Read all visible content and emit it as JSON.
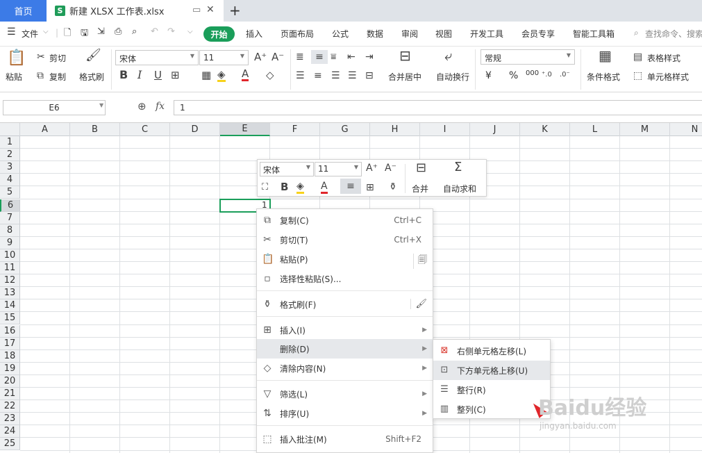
{
  "tabs": {
    "home": "首页",
    "file_logo": "S",
    "file": "新建 XLSX 工作表.xlsx",
    "add": "+"
  },
  "menu": {
    "file_menu": "文件",
    "items": [
      "开始",
      "插入",
      "页面布局",
      "公式",
      "数据",
      "审阅",
      "视图",
      "开发工具",
      "会员专享",
      "智能工具箱"
    ],
    "search": "查找命令、搜索"
  },
  "ribbon": {
    "paste": "粘贴",
    "cut": "剪切",
    "copy": "复制",
    "format_painter": "格式刷",
    "font_name": "宋体",
    "font_size": "11",
    "merge_center": "合并居中",
    "wrap_text": "自动换行",
    "number_format": "常规",
    "conditional_format": "条件格式",
    "table_style": "表格样式",
    "cell_style": "单元格样式",
    "currency": "¥",
    "percent": "%",
    "thousands": "000"
  },
  "formula_bar": {
    "cell_ref": "E6",
    "fx": "fx",
    "value": "1"
  },
  "grid": {
    "columns": [
      "A",
      "B",
      "C",
      "D",
      "E",
      "F",
      "G",
      "H",
      "I",
      "J",
      "K",
      "L",
      "M",
      "N"
    ],
    "rows": [
      "1",
      "2",
      "3",
      "4",
      "5",
      "6",
      "7",
      "8",
      "9",
      "10",
      "11",
      "12",
      "13",
      "14",
      "15",
      "16",
      "17",
      "18",
      "19",
      "20",
      "21",
      "22",
      "23",
      "24",
      "25"
    ],
    "active_cell_value": "1",
    "accent": "#1a9e5a"
  },
  "mini_toolbar": {
    "font_name": "宋体",
    "font_size": "11",
    "merge": "合并",
    "autosum": "自动求和"
  },
  "context_menu": [
    {
      "label": "复制(C)",
      "shortcut": "Ctrl+C"
    },
    {
      "label": "剪切(T)",
      "shortcut": "Ctrl+X"
    },
    {
      "label": "粘贴(P)",
      "shortcut": ""
    },
    {
      "label": "选择性粘贴(S)...",
      "shortcut": ""
    },
    {
      "label": "格式刷(F)",
      "shortcut": ""
    },
    {
      "label": "插入(I)",
      "shortcut": ""
    },
    {
      "label": "删除(D)",
      "shortcut": ""
    },
    {
      "label": "清除内容(N)",
      "shortcut": ""
    },
    {
      "label": "筛选(L)",
      "shortcut": ""
    },
    {
      "label": "排序(U)",
      "shortcut": ""
    },
    {
      "label": "插入批注(M)",
      "shortcut": "Shift+F2"
    }
  ],
  "submenu": [
    "右侧单元格左移(L)",
    "下方单元格上移(U)",
    "整行(R)",
    "整列(C)"
  ],
  "watermark": {
    "brand": "Baidu经验",
    "url": "jingyan.baidu.com"
  }
}
